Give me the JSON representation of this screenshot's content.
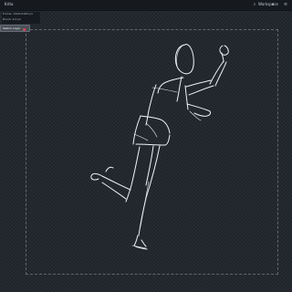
{
  "app": {
    "title": "Krita",
    "workspace": "Workspace"
  },
  "icons": {
    "search": "search-icon",
    "chevron": "chevron-down-icon",
    "menu": "menu-icon"
  },
  "overlay": {
    "line1": "Frame: 1920x1920 px",
    "line2": "Brush: 4.0 px",
    "button_label": "Sketch Layer"
  },
  "colors": {
    "background": "#20252c",
    "stroke": "#f2f4f6",
    "accent": "#e3474c"
  }
}
